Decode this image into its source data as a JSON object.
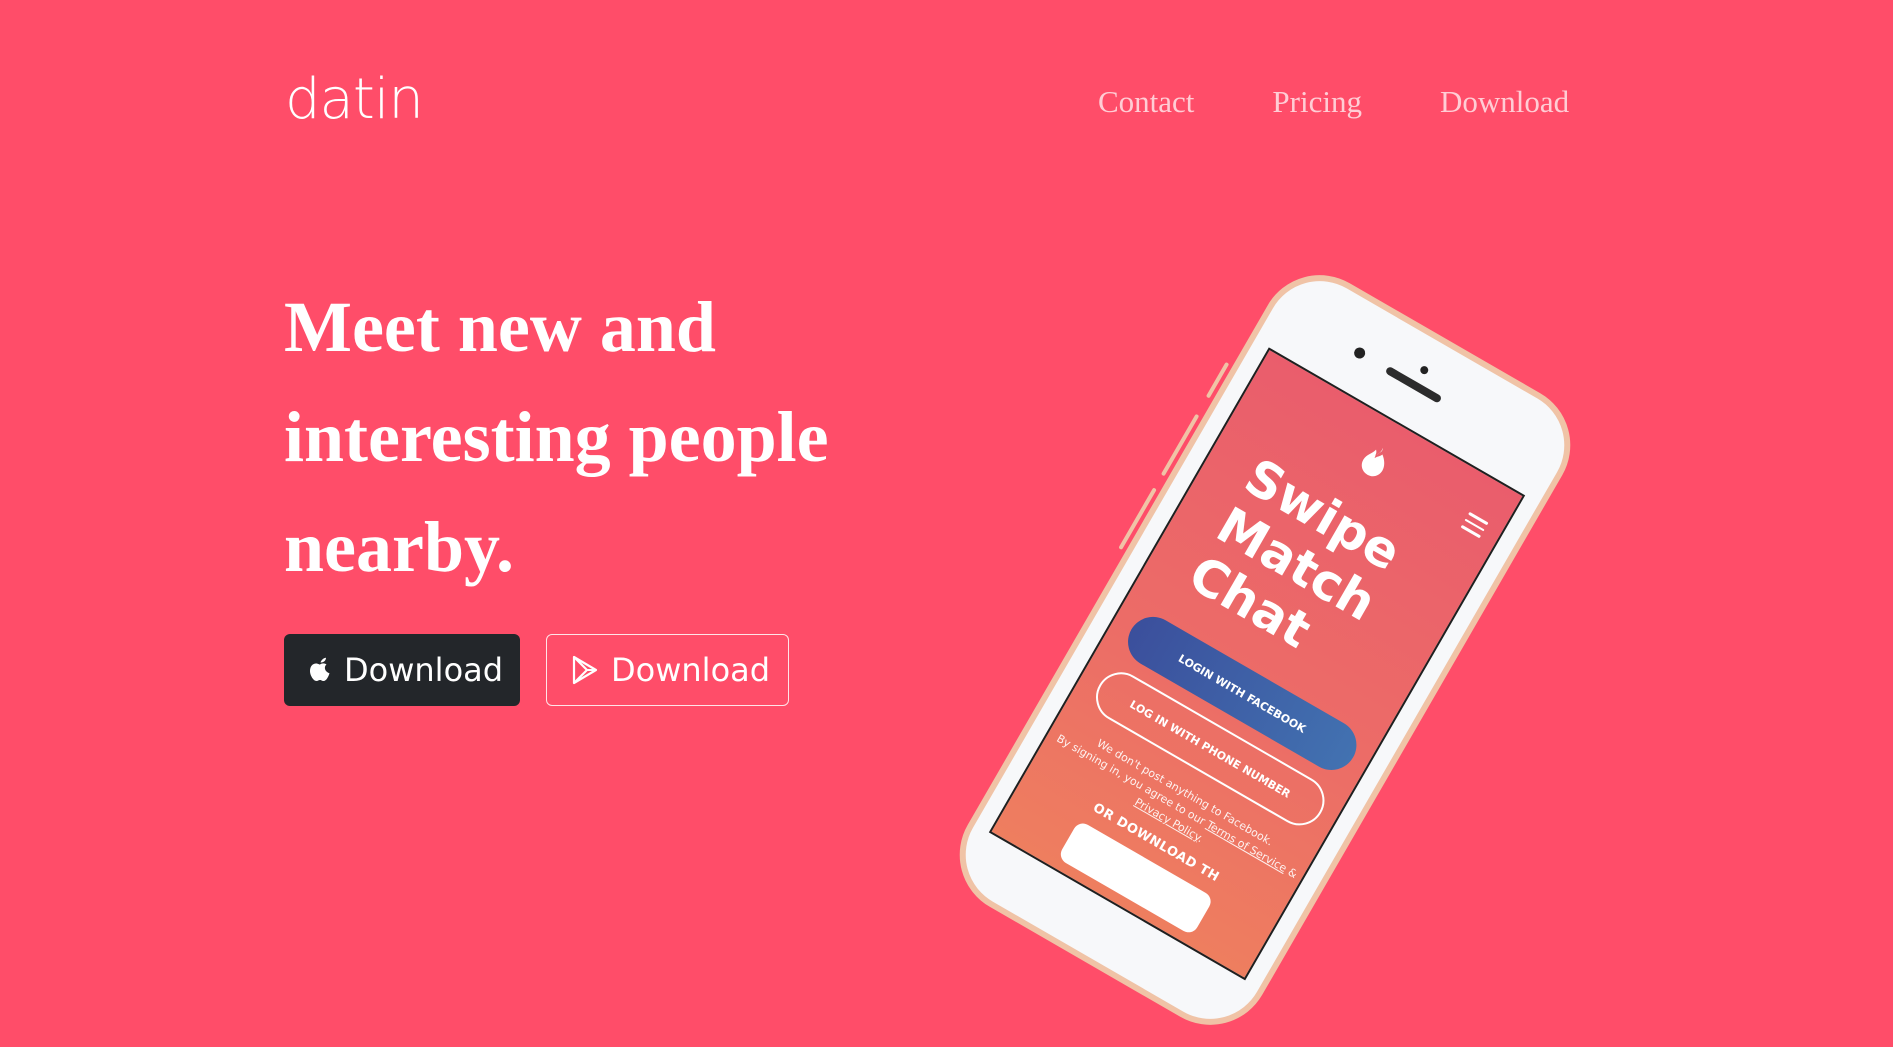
{
  "brand": {
    "logo": "datin"
  },
  "nav": {
    "items": [
      "Contact",
      "Pricing",
      "Download"
    ]
  },
  "hero": {
    "headline_lines": [
      "Meet new and",
      "interesting people",
      "nearby."
    ],
    "apple_button_label": "Download",
    "play_button_label": "Download"
  },
  "phone_screen": {
    "tagline": [
      "Swipe",
      "Match",
      "Chat"
    ],
    "facebook_button": "LOGIN WITH FACEBOOK",
    "phone_button": "LOG IN WITH PHONE NUMBER",
    "note_line1": "We don't post anything to Facebook.",
    "note_line2_prefix": "By signing in, you agree to our",
    "terms_link": "Terms of Service",
    "note_and": "&",
    "privacy_link": "Privacy Policy",
    "note_end": ".",
    "or_download": "OR DOWNLOAD TH"
  },
  "colors": {
    "background": "#ff4d69",
    "apple_button": "#23262a",
    "text": "#ffffff"
  },
  "icons": [
    "apple-icon",
    "google-play-icon",
    "flame-icon",
    "hamburger-menu-icon"
  ]
}
